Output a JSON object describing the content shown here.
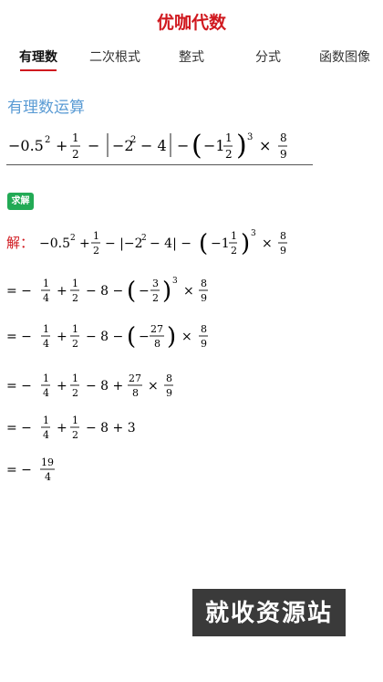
{
  "app_title": "优咖代数",
  "tabs": [
    {
      "label": "有理数",
      "active": true
    },
    {
      "label": "二次根式",
      "active": false
    },
    {
      "label": "整式",
      "active": false
    },
    {
      "label": "分式",
      "active": false
    },
    {
      "label": "函数图像",
      "active": false
    }
  ],
  "section_title": "有理数运算",
  "solve_button": "求解",
  "solution_prefix": "解：",
  "colors": {
    "accent": "#d0191f",
    "section_title": "#5a9bd4",
    "solve_button": "#22aa55"
  },
  "expression_text": "−0.5² + 1/2 − |−2² − 4| − (−1 1/2)³ × 8/9",
  "steps_text": [
    "= −1/4 + 1/2 − 8 − (−3/2)³ × 8/9",
    "= −1/4 + 1/2 − 8 − (−27/8) × 8/9",
    "= −1/4 + 1/2 − 8 + 27/8 × 8/9",
    "= −1/4 + 1/2 − 8 + 3",
    "= −19/4"
  ],
  "watermark": "就收资源站"
}
